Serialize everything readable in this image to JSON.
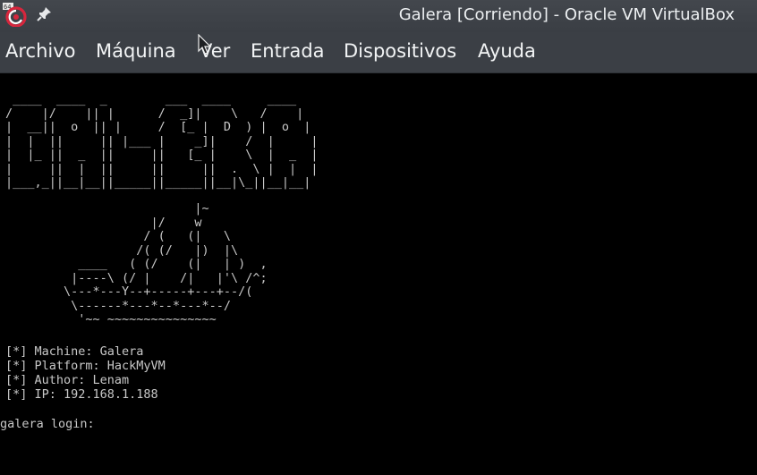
{
  "window": {
    "title": "Galera [Corriendo] - Oracle VM VirtualBox"
  },
  "menu": {
    "items": [
      "Archivo",
      "Máquina",
      "Ver",
      "Entrada",
      "Dispositivos",
      "Ayuda"
    ]
  },
  "icons": {
    "app": "virtualbox-app-icon",
    "pin": "pin-icon",
    "cursor": "mouse-cursor-icon"
  },
  "console": {
    "banner_ascii": " ____  ____  _        ___  ____     ____\n/    |/    || |      /  _]|    \\   /    |\n|  __||  o  || |     /  [_ |  D  ) |  o  |\n|  |  ||     || |___ |    _]|    /  |     |\n|  |_ ||  _  ||     ||   [_ |    \\  |  _  |\n|     ||  |  ||     ||     ||  .  \\ |  |  |\n|___,_||__|__||_____||_____||__|\\_||__|__|",
    "ship_ascii": "                          |~\n                    |/    w\n                   / (   (|   \\\n                  /( (/   |)  |\\\n          ____   ( (/    (|   | )  ,\n         |----\\ (/ |    /|   |'\\ /^;\n        \\---*---Y--+-----+---+--/(\n         \\------*---*--*---*--/\n          '~~ ~~~~~~~~~~~~~~~",
    "info_lines": [
      "[*] Machine: Galera",
      "[*] Platform: HackMyVM",
      "[*] Author: Lenam",
      "[*] IP: 192.168.1.188"
    ],
    "login_prompt": "galera login:",
    "login_value": ""
  },
  "colors": {
    "titlebar": "#3f4349",
    "menubar": "#3b3f45",
    "console_bg": "#000000",
    "console_text": "#c8c8c8"
  }
}
